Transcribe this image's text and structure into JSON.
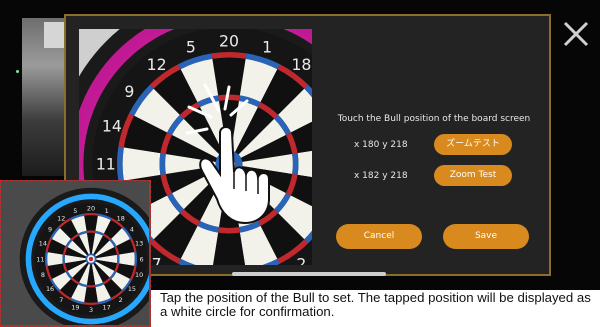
{
  "dialog": {
    "instruction": "Touch the Bull position of the board screen",
    "readout_1": "x 180 y 218",
    "readout_2": "x 182 y 218",
    "zoom_button_1": "ズームテスト",
    "zoom_button_2": "Zoom Test",
    "cancel_label": "Cancel",
    "save_label": "Save"
  },
  "dartboard": {
    "numbers": [
      "20",
      "1",
      "18",
      "4",
      "13",
      "6",
      "10",
      "15",
      "2",
      "17",
      "3",
      "19",
      "7",
      "16",
      "8",
      "11",
      "14",
      "9",
      "12",
      "5"
    ]
  },
  "caption": "Tap the position of the Bull to set. The tapped position will be displayed as a white circle for confirmation.",
  "icons": {
    "close": "close-icon",
    "tap": "tap-hand-icon"
  },
  "colors": {
    "accent": "#d88a1e",
    "panel_border": "#8a6e2a",
    "panel_bg": "#232323",
    "inset_border": "#d42222"
  }
}
